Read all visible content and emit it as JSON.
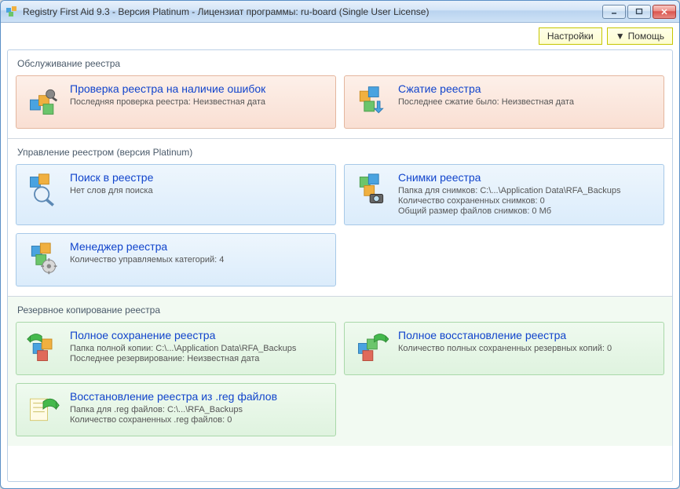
{
  "window": {
    "title": "Registry First Aid 9.3 - Версия Platinum - Лицензиат программы: ru-board (Single User License)"
  },
  "toolbar": {
    "settings": "Настройки",
    "help": "Помощь"
  },
  "sections": {
    "maint": {
      "title": "Обслуживание реестра",
      "check": {
        "title": "Проверка реестра на наличие ошибок",
        "line1": "Последняя проверка реестра: Неизвестная дата"
      },
      "compress": {
        "title": "Сжатие реестра",
        "line1": "Последнее сжатие было: Неизвестная дата"
      }
    },
    "manage": {
      "title": "Управление реестром (версия Platinum)",
      "search": {
        "title": "Поиск в реестре",
        "line1": "Нет слов для поиска"
      },
      "snapshots": {
        "title": "Снимки реестра",
        "line1": "Папка для снимков: C:\\...\\Application Data\\RFA_Backups",
        "line2": "Количество сохраненных снимков: 0",
        "line3": "Общий размер файлов снимков: 0 Мб"
      },
      "manager": {
        "title": "Менеджер реестра",
        "line1": "Количество управляемых категорий: 4"
      }
    },
    "backup": {
      "title": "Резервное копирование реестра",
      "full_save": {
        "title": "Полное сохранение реестра",
        "line1": "Папка полной копии: C:\\...\\Application Data\\RFA_Backups",
        "line2": "Последнее резервирование: Неизвестная дата"
      },
      "full_restore": {
        "title": "Полное восстановление реестра",
        "line1": "Количество полных сохраненных резервных копий: 0"
      },
      "reg_restore": {
        "title": "Восстановление реестра из .reg файлов",
        "line1": "Папка для .reg файлов: C:\\...\\RFA_Backups",
        "line2": "Количество сохраненных .reg файлов: 0"
      }
    }
  }
}
